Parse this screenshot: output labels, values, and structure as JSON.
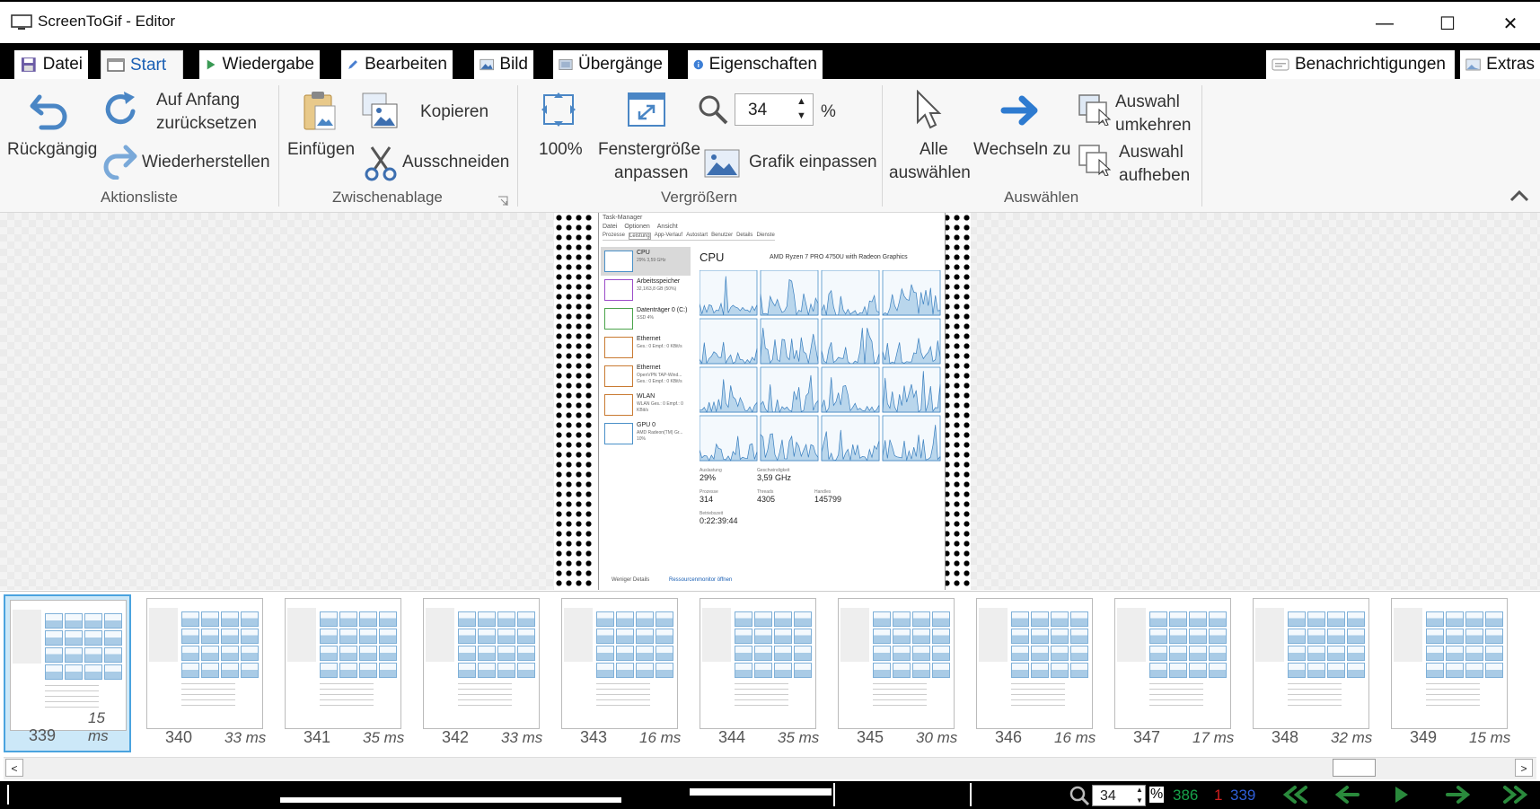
{
  "window": {
    "title": "ScreenToGif - Editor",
    "minimize": "—",
    "maximize": "☐",
    "close": "✕"
  },
  "tabs": [
    {
      "label": "Datei",
      "icon": "save-disk-icon"
    },
    {
      "label": "Start",
      "icon": "screen-icon",
      "active": true
    },
    {
      "label": "Wiedergabe",
      "icon": "play-icon"
    },
    {
      "label": "Bearbeiten",
      "icon": "pencil-icon"
    },
    {
      "label": "Bild",
      "icon": "image-icon"
    },
    {
      "label": "Übergänge",
      "icon": "transition-icon"
    },
    {
      "label": "Eigenschaften",
      "icon": "info-icon"
    },
    {
      "label": "Benachrichtigungen",
      "icon": "notification-icon"
    },
    {
      "label": "Extras",
      "icon": "extras-icon"
    }
  ],
  "ribbon": {
    "undo": "Rückgängig",
    "reset_line1": "Auf Anfang",
    "reset_line2": "zurücksetzen",
    "redo": "Wiederherstellen",
    "group_actions": "Aktionsliste",
    "paste": "Einfügen",
    "copy": "Kopieren",
    "cut": "Ausschneiden",
    "group_clipboard": "Zwischenablage",
    "zoom100": "100%",
    "fit_window_line1": "Fenstergröße",
    "fit_window_line2": "anpassen",
    "zoom_value": "34",
    "zoom_unit": "%",
    "fit_image": "Grafik einpassen",
    "group_zoom": "Vergrößern",
    "select_all_line1": "Alle",
    "select_all_line2": "auswählen",
    "go_to": "Wechseln zu",
    "invert_line1": "Auswahl",
    "invert_line2": "umkehren",
    "deselect_line1": "Auswahl",
    "deselect_line2": "aufheben",
    "group_select": "Auswählen"
  },
  "preview": {
    "app_title": "Task-Manager",
    "menu": [
      "Datei",
      "Optionen",
      "Ansicht"
    ],
    "tabs": [
      "Prozesse",
      "Leistung",
      "App-Verlauf",
      "Autostart",
      "Benutzer",
      "Details",
      "Dienste"
    ],
    "side": [
      {
        "name": "CPU",
        "sub": "29% 3,59 GHz"
      },
      {
        "name": "Arbeitsspeicher",
        "sub": "32,1/63,8 GB (50%)"
      },
      {
        "name": "Datenträger 0 (C:)",
        "sub": "SSD 4%"
      },
      {
        "name": "Ethernet",
        "sub": "Ges.: 0 Empf.: 0 KBit/s"
      },
      {
        "name": "Ethernet",
        "sub": "OpenVPN TAP-Wind... Ges.: 0 Empf.: 0 KBit/s"
      },
      {
        "name": "WLAN",
        "sub": "WLAN Ges.: 0 Empf.: 0 KBit/s"
      },
      {
        "name": "GPU 0",
        "sub": "AMD Radeon(TM) Gr... 10%"
      }
    ],
    "heading": "CPU",
    "cpu_model": "AMD Ryzen 7 PRO 4750U with Radeon Graphics",
    "stats": [
      {
        "label": "Auslastung",
        "value": "29%"
      },
      {
        "label": "Geschwindigkeit",
        "value": "3,59 GHz"
      },
      {
        "label": "Prozesse",
        "value": "314"
      },
      {
        "label": "Threads",
        "value": "4305"
      },
      {
        "label": "Handles",
        "value": "145799"
      },
      {
        "label": "Betriebszeit",
        "value": "0:22:39:44"
      }
    ],
    "footer_less": "Weniger Details",
    "footer_monitor": "Ressourcenmonitor öffnen"
  },
  "frames": [
    {
      "num": "339",
      "dur": "15 ms",
      "selected": true
    },
    {
      "num": "340",
      "dur": "33 ms"
    },
    {
      "num": "341",
      "dur": "35 ms"
    },
    {
      "num": "342",
      "dur": "33 ms"
    },
    {
      "num": "343",
      "dur": "16 ms"
    },
    {
      "num": "344",
      "dur": "35 ms"
    },
    {
      "num": "345",
      "dur": "30 ms"
    },
    {
      "num": "346",
      "dur": "16 ms"
    },
    {
      "num": "347",
      "dur": "17 ms"
    },
    {
      "num": "348",
      "dur": "32 ms"
    },
    {
      "num": "349",
      "dur": "15 ms"
    }
  ],
  "statusbar": {
    "zoom": "34",
    "zoom_unit": "%",
    "total_frames": "386",
    "selected_count": "1",
    "current_frame": "339"
  },
  "colors": {
    "accent": "#1a5fb4",
    "green": "#17a34a",
    "red": "#d21f1f",
    "blue": "#2f5fd8",
    "graph": "#4a90c8"
  }
}
